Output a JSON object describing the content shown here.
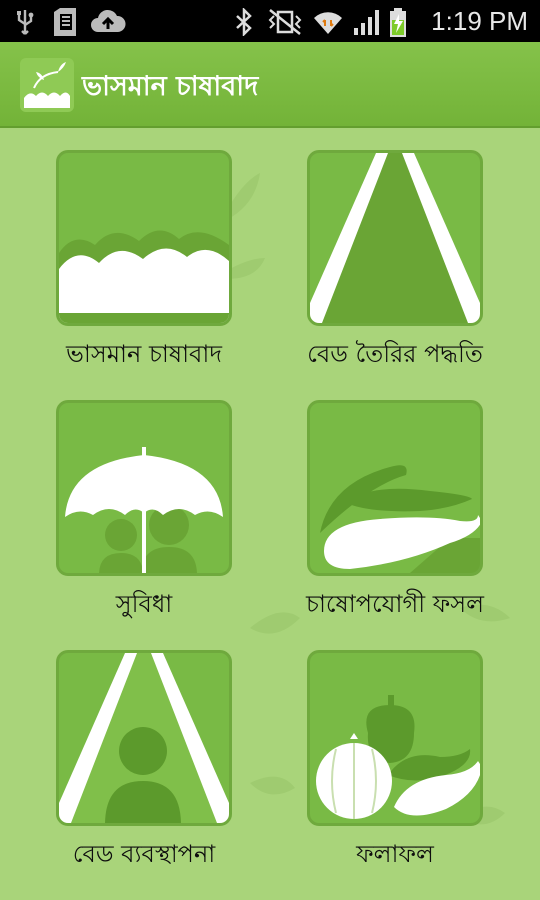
{
  "status_bar": {
    "time": "1:19 PM",
    "icons": [
      "usb-icon",
      "sd-card-icon",
      "cloud-upload-icon",
      "bluetooth-icon",
      "vibrate-icon",
      "wifi-icon",
      "signal-icon",
      "battery-charging-icon"
    ]
  },
  "action_bar": {
    "title": "ভাসমান চাষাবাদ",
    "logo": "floating-garden-logo"
  },
  "menu": {
    "items": [
      {
        "label": "ভাসমান চাষাবাদ",
        "icon": "floating-bed-icon"
      },
      {
        "label": "বেড তৈরির পদ্ধতি",
        "icon": "bed-making-icon"
      },
      {
        "label": "সুবিধা",
        "icon": "umbrella-people-icon"
      },
      {
        "label": "চাষোপযোগী ফসল",
        "icon": "eggplant-icon"
      },
      {
        "label": "বেড ব্যবস্থাপনা",
        "icon": "bed-management-icon"
      },
      {
        "label": "ফলাফল",
        "icon": "vegetables-icon"
      }
    ]
  },
  "colors": {
    "background": "#a9d47a",
    "action_bar": "#7bbb40",
    "tile": "#79ba45",
    "tile_border": "#6fa93d",
    "accent_dark": "#5f9a2f"
  }
}
